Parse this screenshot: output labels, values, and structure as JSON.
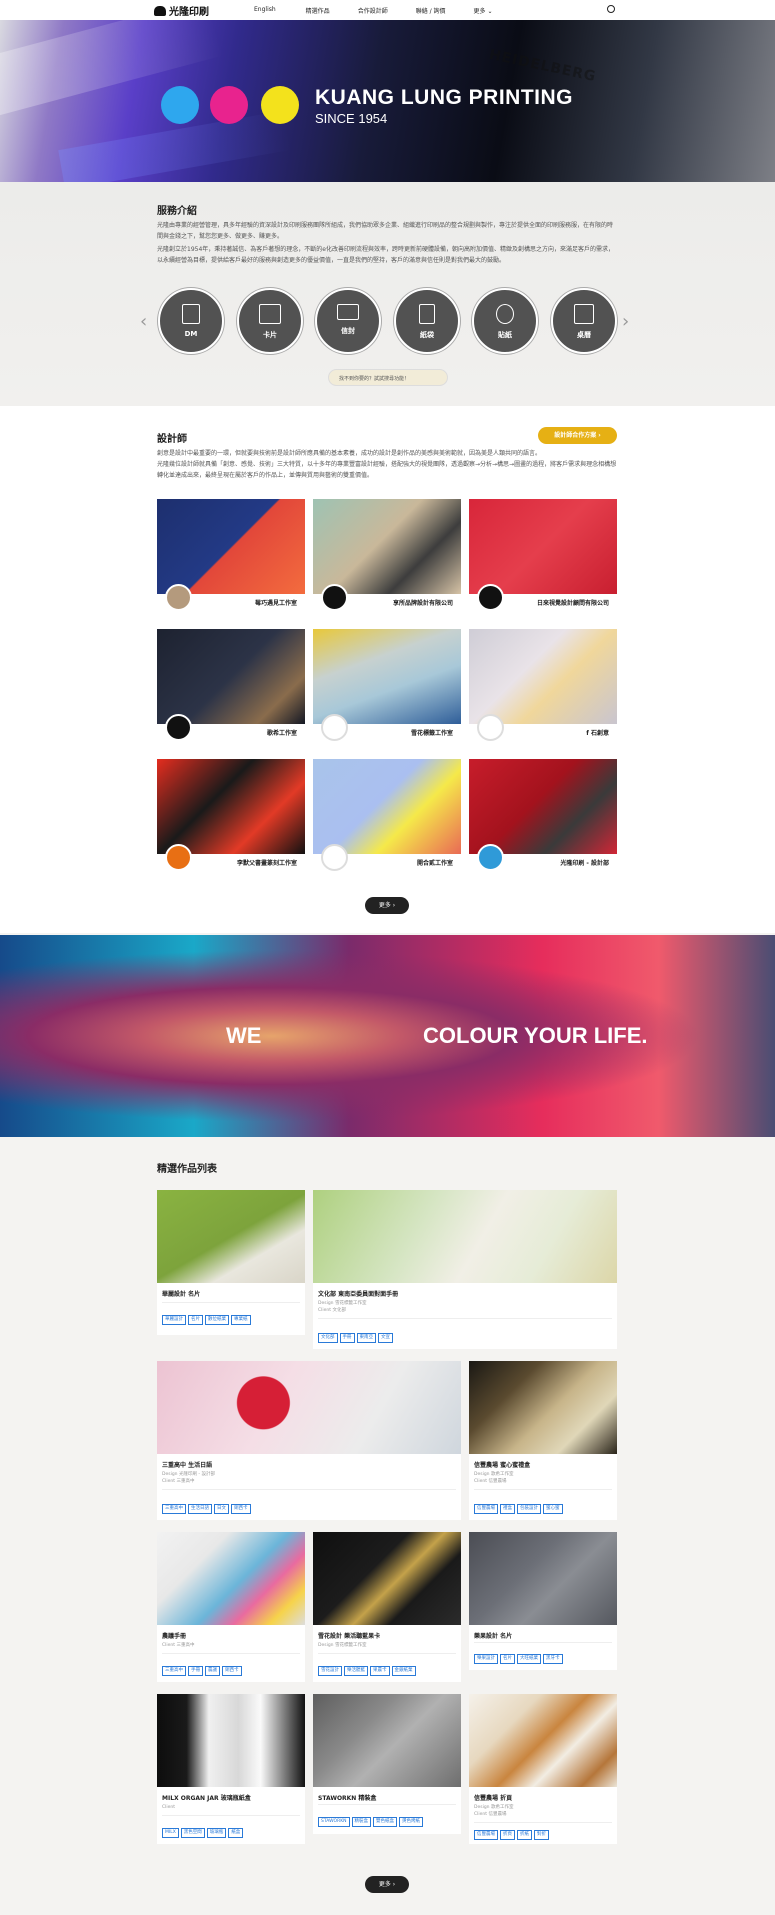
{
  "nav": {
    "logo": "光隆印刷",
    "items": [
      "English",
      "精選作品",
      "合作設計師",
      "聯絡 / 詢價",
      "更多 ⌄"
    ]
  },
  "hero": {
    "title": "KUANG LUNG PRINTING",
    "subtitle": "SINCE 1954",
    "brand_mark": "HEIDELBERG",
    "colors": {
      "cyan": "#2ea7ee",
      "magenta": "#e8238e",
      "yellow": "#f3e21c"
    }
  },
  "services": {
    "title": "服務介紹",
    "p1": "光隆由專業的經營管理，具多年經驗的資深設計及印刷服務團隊所組成，我們協助眾多企業、組織進行印刷品的整合規劃與製作，專注於提供全面的印刷服務服，在有限的時間與金錢之下，幫您您更多、做更多、賺更多。",
    "p2": "光隆創立於1954年，秉持著誠信、為客戶著想的理念，不斷的e化改善印刷流程與效率，跨時更新前硬體設備，朝向高附加價值、精緻及創構思之方向，來滿足客戶的需求，以永續經營為目標，提供給客戶最好的服務與創造更多的優益價值，一直是我們的堅持，客戶的滿意與信任則是對我們最大的鼓勵。",
    "items": [
      "DM",
      "卡片",
      "信封",
      "紙袋",
      "貼紙",
      "桌曆"
    ],
    "search_placeholder": "找不到你要的？試試搜尋功能！"
  },
  "designers": {
    "title": "設計師",
    "cta": "設計師合作方案 ›",
    "p1": "創意是設計中最重要的一環，但就要與技術前是設計師所應具備的基本素養，成功的設計是創作品的美感與美術範就，因為美是人類共同的語言。",
    "p2": "光隆幾位設計師就具備「創意、感覺、技術」三大特質，以十多年的專業豐富設計經驗，搭配強大的視覺團隊，透過觀察→分析→構思→圖畫的過程，將客戶需求與理念相構想轉化並達成出來，最終呈現在屬於客戶的作品上，並傳與質用與藝術的雙重價值。",
    "cards": [
      "莓巧遇見工作室",
      "享所品牌設計有限公司",
      "日來視覺設計顧問有限公司",
      "歌希工作室",
      "雪花標籤工作室",
      "f 石創意",
      "李默父書畫篆刻工作室",
      "開合貳工作室",
      "光隆印刷 - 設計部"
    ],
    "more": "更多 ›"
  },
  "banner": {
    "left": "WE",
    "right": "COLOUR YOUR LIFE."
  },
  "works": {
    "title": "精選作品列表",
    "more": "更多 ›",
    "items": [
      {
        "title": "華麗設計 名片",
        "design": "",
        "client": "",
        "tags": [
          "華麗設計",
          "名片",
          "數位紙業",
          "專業紙"
        ]
      },
      {
        "title": "文化部 東南亞委員面對面手冊",
        "design": "Design  雪花標籤工作室",
        "client": "Client  文化部",
        "tags": [
          "文化部",
          "手冊",
          "東南亞",
          "文宣"
        ]
      },
      {
        "title": "三重高中 生活日語",
        "design": "Design  光隆印刷 - 設計部",
        "client": "Client  三重高中",
        "tags": [
          "三重高中",
          "生活日語",
          "日文",
          "銅西卡"
        ]
      },
      {
        "title": "信豐農場 蜜心蜜禮盒",
        "design": "Design  歌希工作室",
        "client": "Client  信豐農場",
        "tags": [
          "信豐農場",
          "禮盒",
          "包裝設計",
          "蜜心蜜"
        ]
      },
      {
        "title": "農議手冊",
        "design": "",
        "client": "Client  三重高中",
        "tags": [
          "三重高中",
          "手冊",
          "農議",
          "銅西卡"
        ]
      },
      {
        "title": "雪花設計 樂活聽藍果卡",
        "design": "Design  雪花標籤工作室",
        "client": "",
        "tags": [
          "雪花設計",
          "樂活聽藍",
          "果農卡",
          "金銀紙業"
        ]
      },
      {
        "title": "樂果設計 名片",
        "design": "",
        "client": "",
        "tags": [
          "樂果設計",
          "名片",
          "大旺紙業",
          "黑牙卡"
        ]
      },
      {
        "title": "MILX ORGAN JAR 玻璃瓶紙盒",
        "design": "",
        "client": "Client",
        "tags": [
          "MILX",
          "黑色空間",
          "玻璃瓶",
          "紙盒"
        ]
      },
      {
        "title": "STAWORKN 精裝盒",
        "design": "",
        "client": "",
        "tags": [
          "STAWORKN",
          "精裝盒",
          "雙色紙盒",
          "燙色烤紙"
        ]
      },
      {
        "title": "信豐農場 折頁",
        "design": "Design  歌希工作室",
        "client": "Client  信豐農場",
        "tags": [
          "信豐農場",
          "折頁",
          "折紙",
          "對折"
        ]
      }
    ]
  }
}
